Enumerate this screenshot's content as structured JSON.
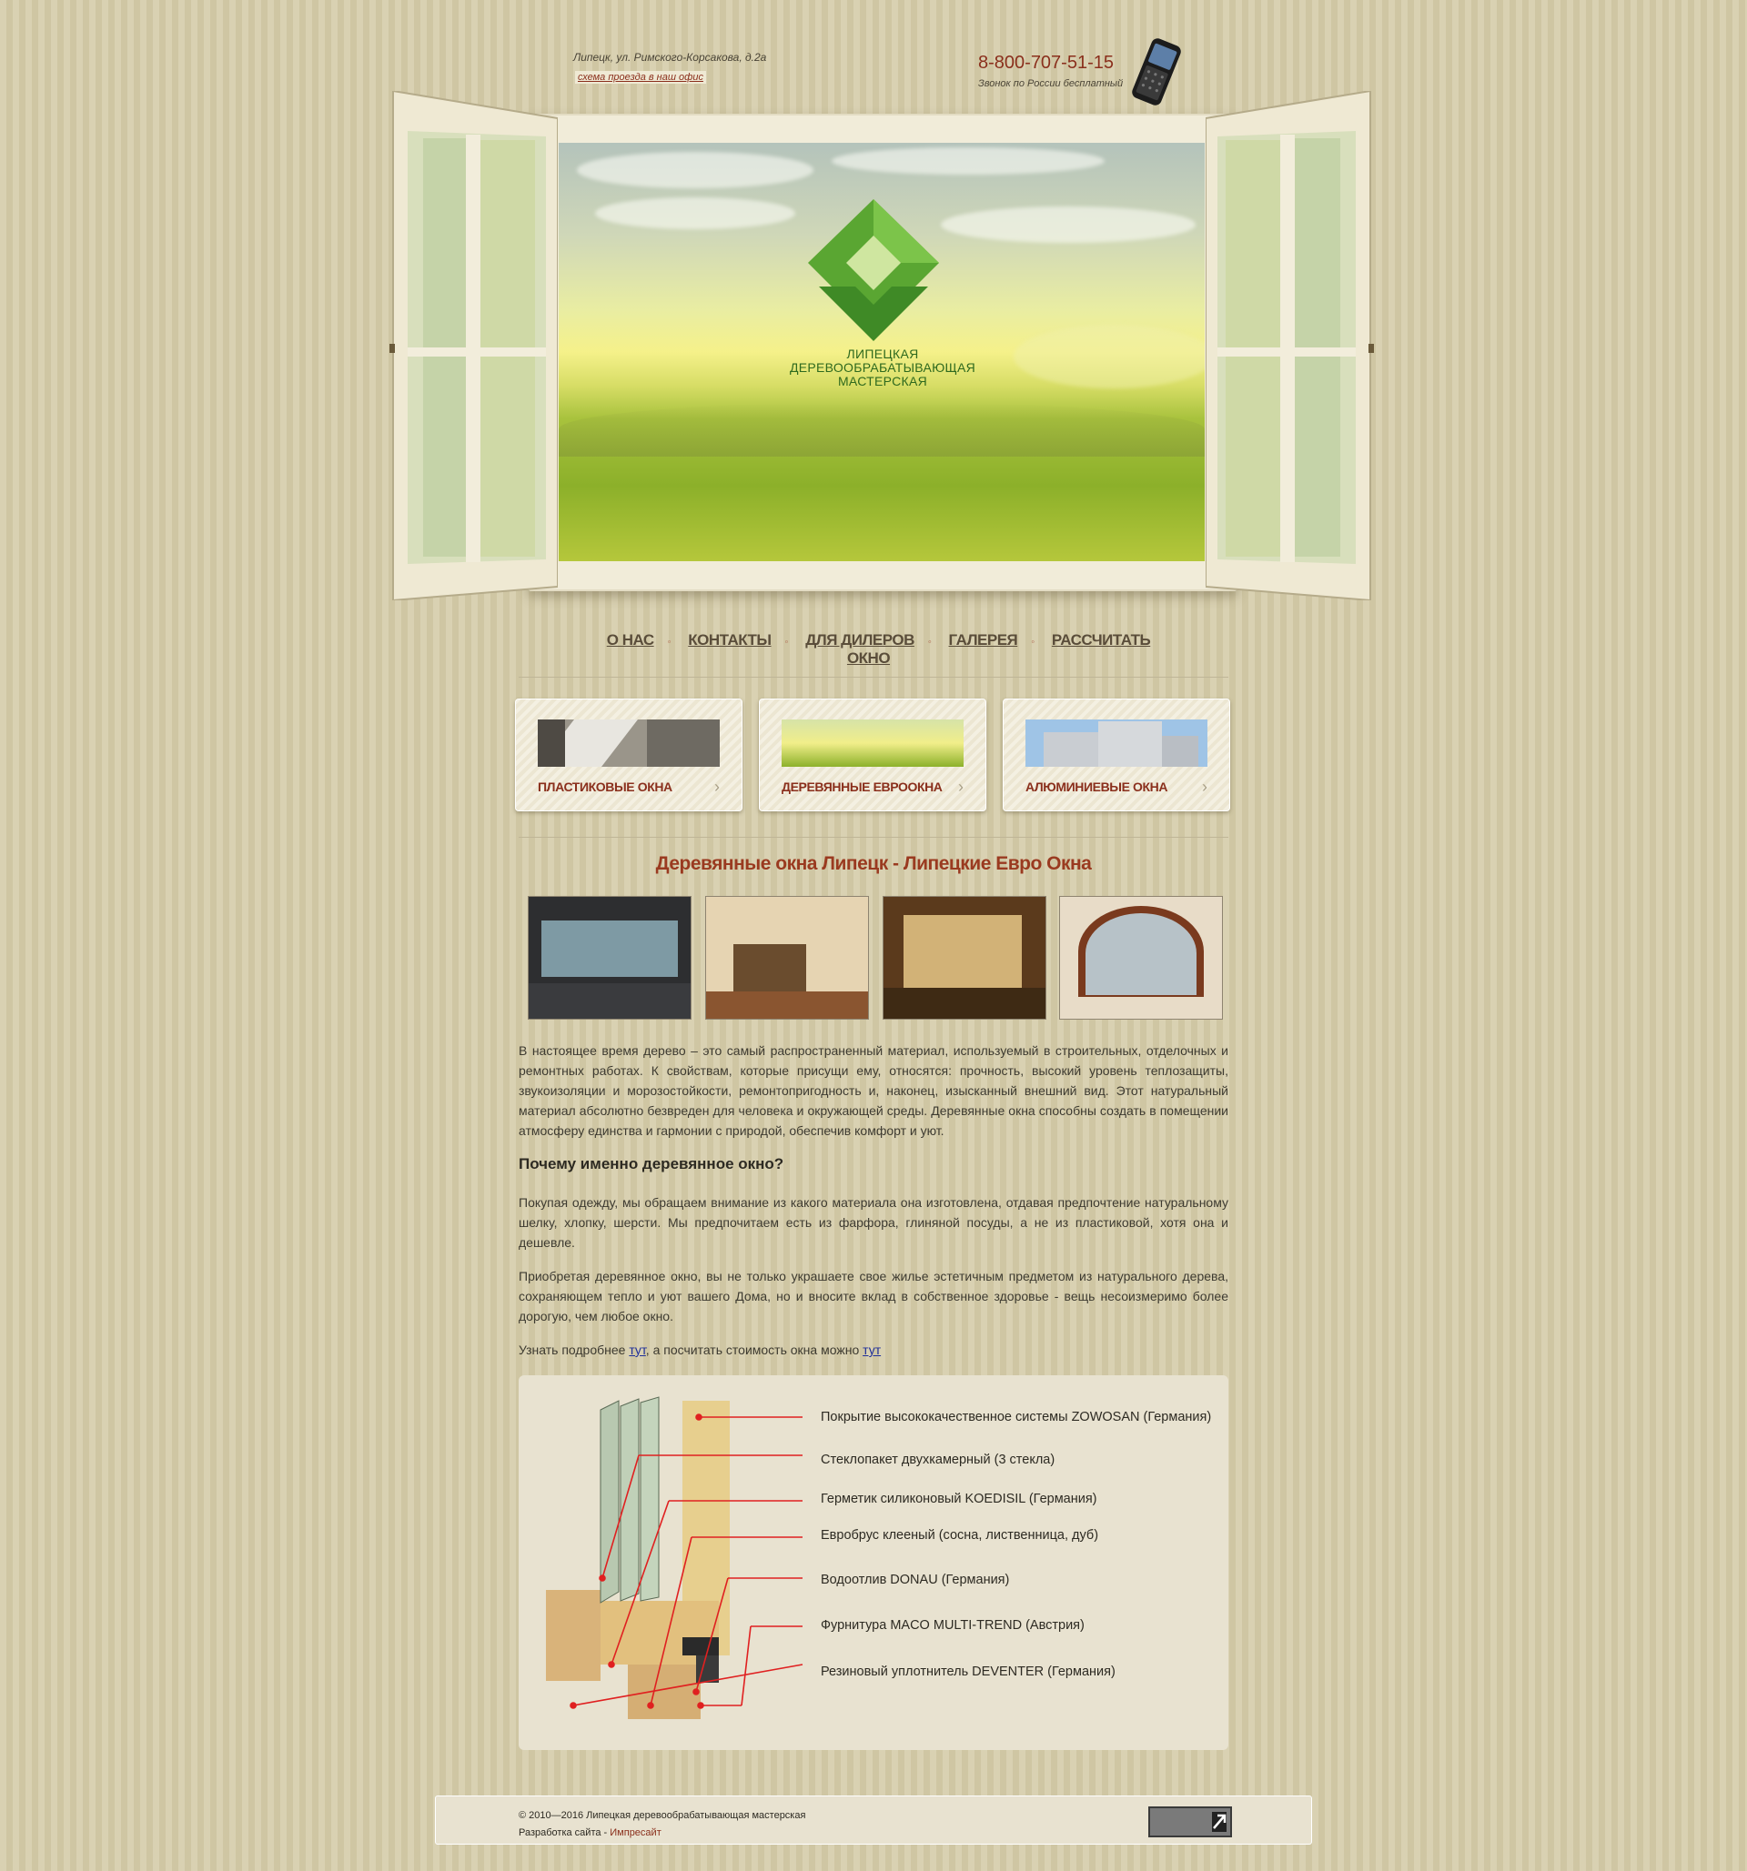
{
  "header": {
    "address": "Липецк, ул. Римского-Корсакова, д.2а",
    "map_link": "схема проезда в наш офис",
    "phone": "8-800-707-51-15",
    "phone_note": "Звонок по России бесплатный"
  },
  "logo": {
    "line1": "ЛИПЕЦКАЯ",
    "line2": "ДЕРЕВООБРАБАТЫВАЮЩАЯ",
    "line3": "МАСТЕРСКАЯ",
    "color": "#5aa632"
  },
  "menu": [
    "О НАС",
    "КОНТАКТЫ",
    "ДЛЯ ДИЛЕРОВ",
    "ГАЛЕРЕЯ",
    "РАССЧИТАТЬ ОКНО"
  ],
  "cards": [
    {
      "label": "ПЛАСТИКОВЫЕ ОКНА"
    },
    {
      "label": "ДЕРЕВЯННЫЕ ЕВРООКНА"
    },
    {
      "label": "АЛЮМИНИЕВЫЕ ОКНА"
    }
  ],
  "main": {
    "title": "Деревянные окна Липецк - Липецкие Евро Окна",
    "para1": "В настоящее время дерево – это самый распространенный материал, используемый в строительных, отделочных и ремонтных работах. К свойствам, которые присущи ему, относятся: прочность, высокий уровень теплозащиты, звукоизоляции и морозостойкости, ремонтопригодность и, наконец, изысканный внешний вид. Этот натуральный материал абсолютно безвреден для человека и окружающей среды. Деревянные окна способны создать в помещении атмосферу единства и гармонии с природой, обеспечив комфорт и уют.",
    "subtitle": "Почему именно деревянное окно?",
    "para2": "Покупая одежду, мы обращаем внимание из какого материала она изготовлена, отдавая предпочтение натуральному шелку, хлопку, шерсти. Мы предпочитаем есть из фарфора, глиняной посуды, а не из пластиковой, хотя она и дешевле.",
    "para3": "Приобретая деревянное окно, вы не только украшаете свое жилье эстетичным предметом из натурального дерева, сохраняющем тепло и уют вашего Дома, но и вносите вклад в собственное здоровье - вещь несоизмеримо более дорогую, чем любое окно.",
    "more_prefix": "Узнать подробнее ",
    "more_link1": "тут",
    "more_middle": ", а посчитать стоимость окна можно ",
    "more_link2": "тут"
  },
  "spec": [
    "Покрытие высококачественное системы ZOWOSAN (Германия)",
    "Стеклопакет двухкамерный (3 стекла)",
    "Герметик силиконовый KOEDISIL (Германия)",
    "Евробрус клееный (сосна, лиственница, дуб)",
    "Водоотлив DONAU (Германия)",
    "Фурнитура MACO MULTI-TREND (Австрия)",
    "Резиновый уплотнитель DEVENTER (Германия)"
  ],
  "footer": {
    "copyright": "© 2010—2016 Липецкая деревообрабатывающая мастерская",
    "dev_prefix": "Разработка сайта - ",
    "dev_link": "Импресайт"
  },
  "colors": {
    "accent": "#8a2f1c",
    "heading": "#9a3a20",
    "leader": "#e02020"
  }
}
